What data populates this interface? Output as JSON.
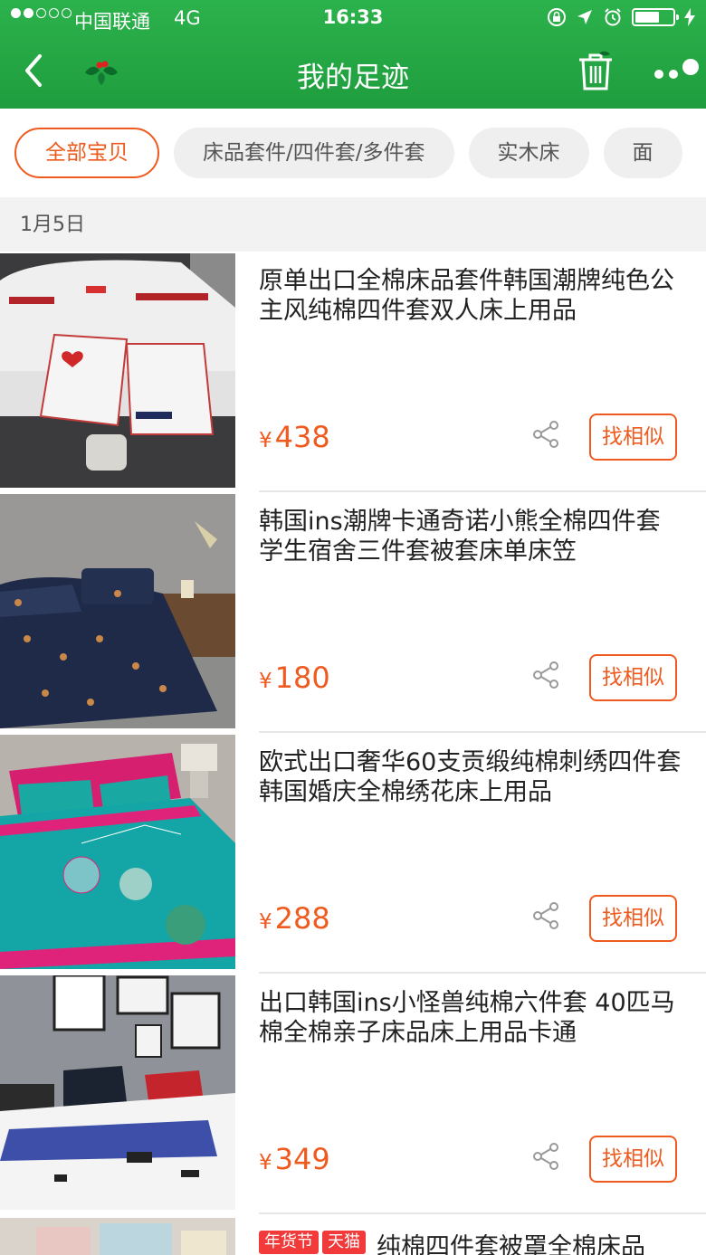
{
  "status_bar": {
    "carrier": "中国联通",
    "network": "4G",
    "time": "16:33"
  },
  "nav": {
    "title": "我的足迹"
  },
  "tabs": [
    {
      "label": "全部宝贝",
      "active": true
    },
    {
      "label": "床品套件/四件套/多件套",
      "active": false
    },
    {
      "label": "实木床",
      "active": false
    },
    {
      "label": "面",
      "active": false
    }
  ],
  "section": {
    "date": "1月5日"
  },
  "colors": {
    "header_green": "#2cb24c",
    "accent_orange": "#ef5a1e"
  },
  "items": [
    {
      "title": "原单出口全棉床品套件韩国潮牌纯色公主风纯棉四件套双人床上用品",
      "currency": "¥",
      "price": "438",
      "similar_label": "找相似"
    },
    {
      "title": "韩国ins潮牌卡通奇诺小熊全棉四件套学生宿舍三件套被套床单床笠",
      "currency": "¥",
      "price": "180",
      "similar_label": "找相似"
    },
    {
      "title": "欧式出口奢华60支贡缎纯棉刺绣四件套 韩国婚庆全棉绣花床上用品",
      "currency": "¥",
      "price": "288",
      "similar_label": "找相似"
    },
    {
      "title": "出口韩国ins小怪兽纯棉六件套 40匹马棉全棉亲子床品床上用品卡通",
      "currency": "¥",
      "price": "349",
      "similar_label": "找相似"
    }
  ],
  "partial_item": {
    "badges": [
      "年货节",
      "天猫"
    ],
    "title": "纯棉四件套被罩全棉床品"
  }
}
